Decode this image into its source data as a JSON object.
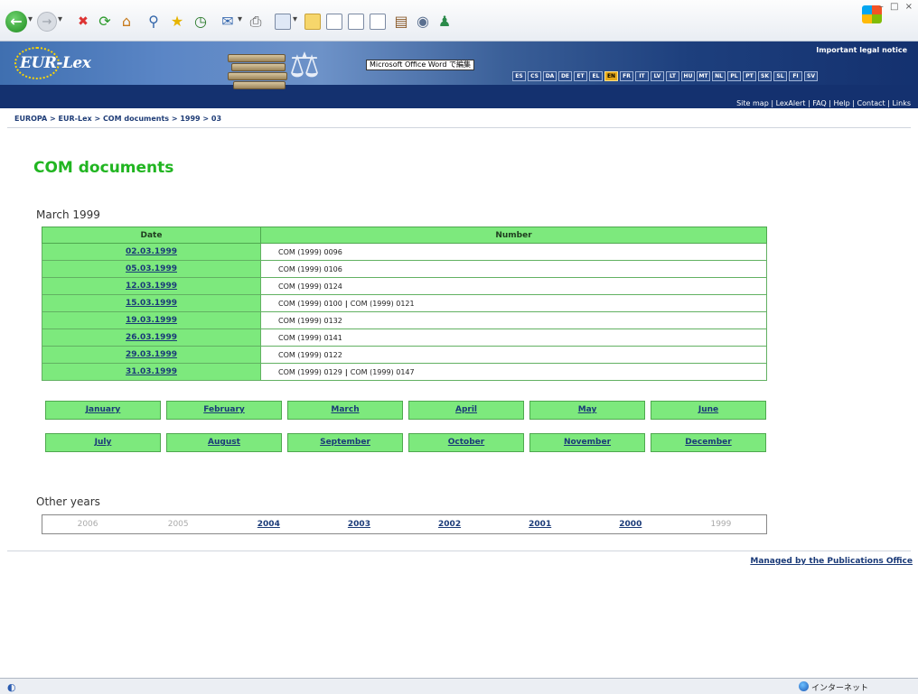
{
  "banner": {
    "logo_text": "EUR-Lex",
    "word_popup": "Microsoft Office Word で編集",
    "legal_notice": "Important legal notice",
    "languages": [
      "ES",
      "CS",
      "DA",
      "DE",
      "ET",
      "EL",
      "EN",
      "FR",
      "IT",
      "LV",
      "LT",
      "HU",
      "MT",
      "NL",
      "PL",
      "PT",
      "SK",
      "SL",
      "FI",
      "SV"
    ],
    "active_language": "EN",
    "util_links": [
      "Site map",
      "LexAlert",
      "FAQ",
      "Help",
      "Contact",
      "Links"
    ],
    "util_sep": " | "
  },
  "breadcrumb": {
    "items": [
      "EUROPA",
      "EUR-Lex",
      "COM documents",
      "1999",
      "03"
    ],
    "sep": " > "
  },
  "page": {
    "title": "COM documents",
    "month_heading": "March 1999"
  },
  "table": {
    "headers": {
      "date": "Date",
      "number": "Number"
    },
    "rows": [
      {
        "date": "02.03.1999",
        "numbers": [
          "COM (1999) 0096"
        ]
      },
      {
        "date": "05.03.1999",
        "numbers": [
          "COM (1999) 0106"
        ]
      },
      {
        "date": "12.03.1999",
        "numbers": [
          "COM (1999) 0124"
        ]
      },
      {
        "date": "15.03.1999",
        "numbers": [
          "COM (1999) 0100",
          "COM (1999) 0121"
        ]
      },
      {
        "date": "19.03.1999",
        "numbers": [
          "COM (1999) 0132"
        ]
      },
      {
        "date": "26.03.1999",
        "numbers": [
          "COM (1999) 0141"
        ]
      },
      {
        "date": "29.03.1999",
        "numbers": [
          "COM (1999) 0122"
        ]
      },
      {
        "date": "31.03.1999",
        "numbers": [
          "COM (1999) 0129",
          "COM (1999) 0147"
        ]
      }
    ]
  },
  "months": {
    "row1": [
      "January",
      "February",
      "March",
      "April",
      "May",
      "June"
    ],
    "row2": [
      "July",
      "August",
      "September",
      "October",
      "November",
      "December"
    ]
  },
  "years": {
    "heading": "Other years",
    "items": [
      {
        "label": "2006",
        "state": "disabled"
      },
      {
        "label": "2005",
        "state": "disabled"
      },
      {
        "label": "2004",
        "state": "link"
      },
      {
        "label": "2003",
        "state": "link"
      },
      {
        "label": "2002",
        "state": "link"
      },
      {
        "label": "2001",
        "state": "link"
      },
      {
        "label": "2000",
        "state": "link"
      },
      {
        "label": "1999",
        "state": "disabled"
      }
    ]
  },
  "footer": {
    "publications_link": "Managed by the Publications Office"
  },
  "statusbar": {
    "zone": "インターネット"
  },
  "colors": {
    "banner_bg": "#14316f",
    "table_green": "#7de97d",
    "title_green": "#21b521",
    "link_blue": "#1a3a78"
  }
}
